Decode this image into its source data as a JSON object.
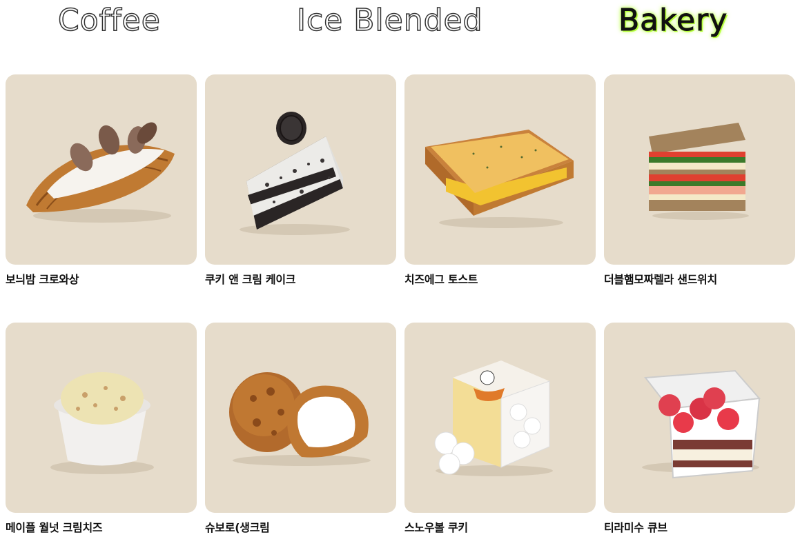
{
  "tabs": {
    "coffee": "Coffee",
    "ice_blended": "Ice Blended",
    "bakery": "Bakery"
  },
  "colors": {
    "card_bg": "#e6dccb",
    "active_glow": "#b6ff3b"
  },
  "products": [
    {
      "name": "보늬밤 크로와상"
    },
    {
      "name": "쿠키 앤 크림 케이크"
    },
    {
      "name": "치즈에그 토스트"
    },
    {
      "name": "더블햄모짜렐라 샌드위치"
    },
    {
      "name": "메이플 월넛 크림치즈"
    },
    {
      "name": "슈보로(생크림"
    },
    {
      "name": "스노우볼 쿠키"
    },
    {
      "name": "티라미수 큐브"
    }
  ]
}
